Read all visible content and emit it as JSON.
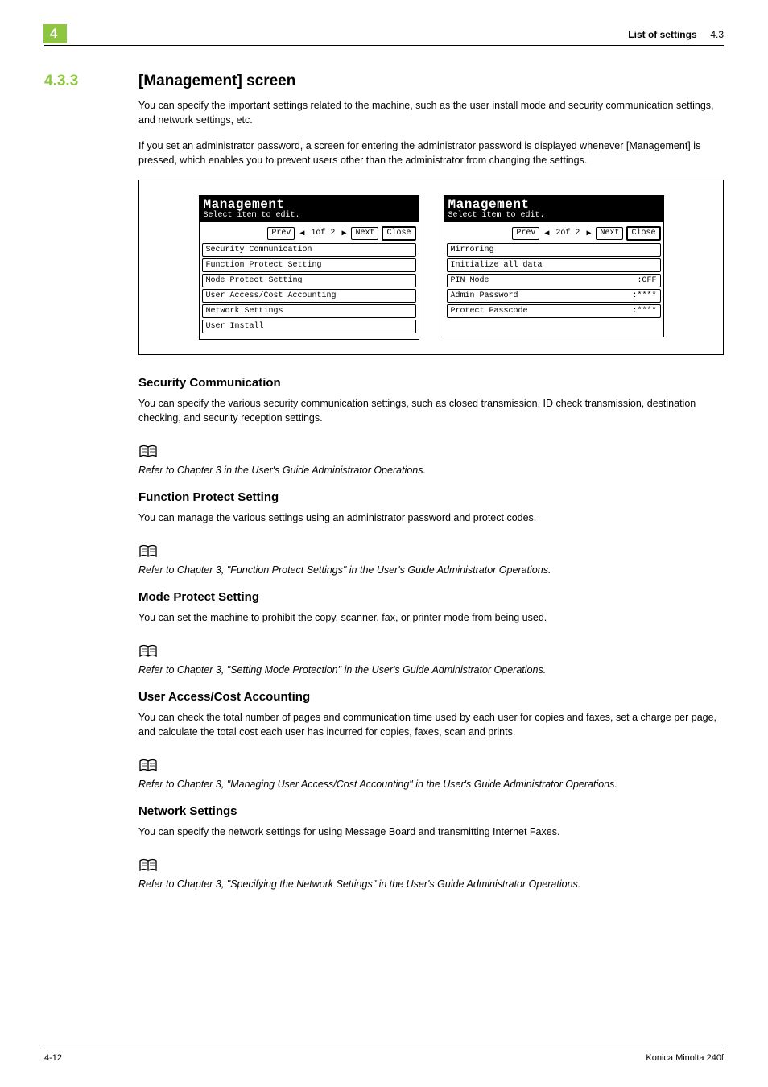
{
  "header": {
    "chapter_marker": "4",
    "right_label_bold": "List of settings",
    "right_label_num": "4.3"
  },
  "section": {
    "number": "4.3.3",
    "title": "[Management] screen",
    "intro1": "You can specify the important settings related to the machine, such as the user install mode and security communication settings, and network settings, etc.",
    "intro2": "If you set an administrator password, a screen for entering the administrator password is displayed whenever [Management] is pressed, which enables you to prevent users other than the administrator from changing the settings."
  },
  "screens": {
    "title_big": "Management",
    "title_small": "Select item to edit.",
    "prev": "Prev",
    "next": "Next",
    "close": "Close",
    "page1_label": "1of  2",
    "page2_label": "2of  2",
    "page1_items": [
      {
        "label": "Security Communication",
        "value": ""
      },
      {
        "label": "Function Protect Setting",
        "value": ""
      },
      {
        "label": "Mode Protect Setting",
        "value": ""
      },
      {
        "label": "User Access/Cost Accounting",
        "value": ""
      },
      {
        "label": "Network Settings",
        "value": ""
      },
      {
        "label": "User Install",
        "value": ""
      }
    ],
    "page2_items": [
      {
        "label": "Mirroring",
        "value": ""
      },
      {
        "label": "Initialize all data",
        "value": ""
      },
      {
        "label": "PIN Mode",
        "value": ":OFF"
      },
      {
        "label": "Admin Password",
        "value": ":****"
      },
      {
        "label": "Protect Passcode",
        "value": ":****"
      }
    ]
  },
  "subsections": [
    {
      "heading": "Security Communication",
      "body": "You can specify the various security communication settings, such as closed transmission, ID check transmission, destination checking, and security reception settings.",
      "ref": "Refer to Chapter 3 in the User's Guide Administrator Operations."
    },
    {
      "heading": "Function Protect Setting",
      "body": "You can manage the various settings using an administrator password and protect codes.",
      "ref": "Refer to Chapter 3, \"Function Protect Settings\" in the User's Guide Administrator Operations."
    },
    {
      "heading": "Mode Protect Setting",
      "body": "You can set the machine to prohibit the copy, scanner, fax, or printer mode from being used.",
      "ref": "Refer to Chapter 3, \"Setting Mode Protection\" in the User's Guide Administrator Operations."
    },
    {
      "heading": "User Access/Cost Accounting",
      "body": "You can check the total number of pages and communication time used by each user for copies and faxes, set a charge per page, and calculate the total cost each user has incurred for copies, faxes, scan and prints.",
      "ref": "Refer to Chapter 3, \"Managing User Access/Cost Accounting\" in the User's Guide Administrator Operations."
    },
    {
      "heading": "Network Settings",
      "body": "You can specify the network settings for using Message Board and transmitting Internet Faxes.",
      "ref": "Refer to Chapter 3, \"Specifying the Network Settings\" in the User's Guide Administrator Operations."
    }
  ],
  "footer": {
    "page": "4-12",
    "product": "Konica Minolta 240f"
  }
}
